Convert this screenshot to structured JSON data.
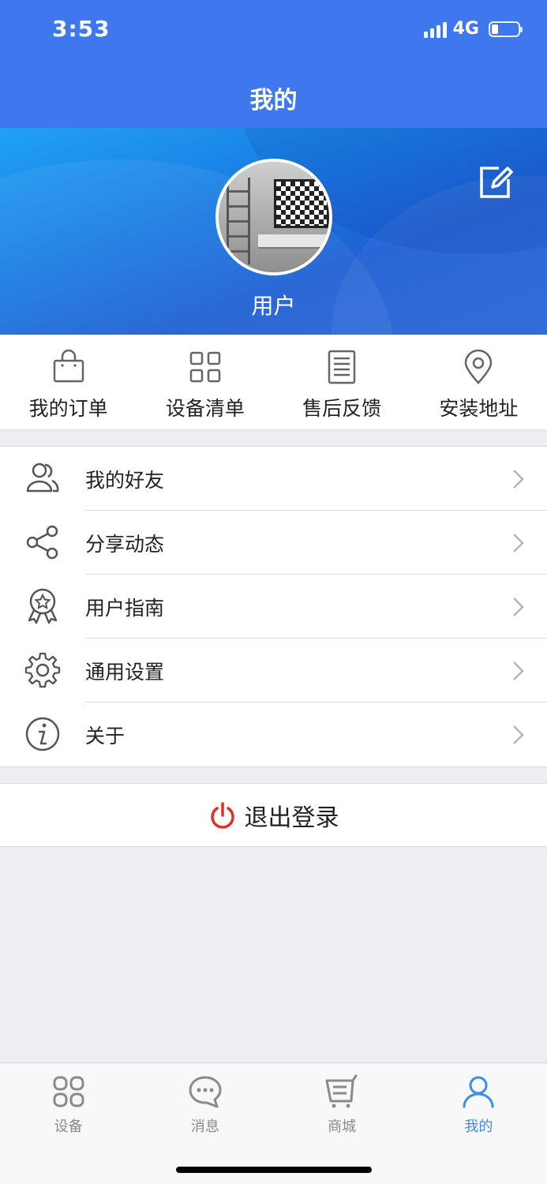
{
  "status_bar": {
    "time": "3:53",
    "network": "4G",
    "battery_level": 0.22
  },
  "nav": {
    "title": "我的"
  },
  "profile": {
    "username": "用户"
  },
  "quick_actions": [
    {
      "label": "我的订单",
      "icon": "shopping-bag-icon"
    },
    {
      "label": "设备清单",
      "icon": "grid-icon"
    },
    {
      "label": "售后反馈",
      "icon": "document-list-icon"
    },
    {
      "label": "安装地址",
      "icon": "location-pin-icon"
    }
  ],
  "menu": [
    {
      "label": "我的好友",
      "icon": "friends-icon"
    },
    {
      "label": "分享动态",
      "icon": "share-icon"
    },
    {
      "label": "用户指南",
      "icon": "award-badge-icon"
    },
    {
      "label": "通用设置",
      "icon": "gear-icon"
    },
    {
      "label": "关于",
      "icon": "info-icon"
    }
  ],
  "logout": {
    "label": "退出登录",
    "icon": "power-icon",
    "icon_color": "#e03020"
  },
  "tabbar": {
    "active_index": 3,
    "active_color": "#3a8ee6",
    "inactive_color": "#8a8a8a",
    "tabs": [
      {
        "label": "设备",
        "icon": "devices-icon"
      },
      {
        "label": "消息",
        "icon": "message-icon"
      },
      {
        "label": "商城",
        "icon": "store-cart-icon"
      },
      {
        "label": "我的",
        "icon": "user-icon"
      }
    ]
  },
  "colors": {
    "header_blue": "#3f78ee",
    "banner_blue": "#1b7fe4",
    "page_bg": "#ededf2"
  }
}
